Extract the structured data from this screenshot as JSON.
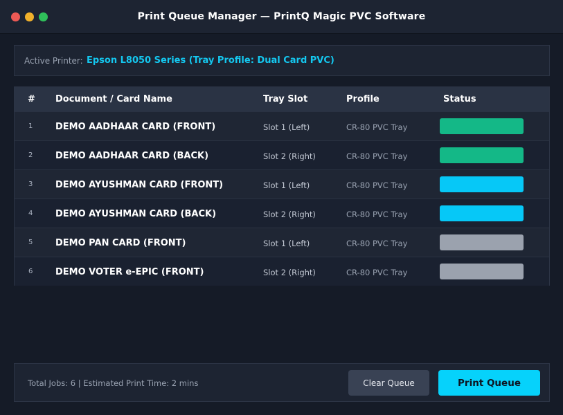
{
  "window": {
    "title": "Print Queue Manager — PrintQ Magic PVC Software"
  },
  "printer": {
    "label": "Active Printer:",
    "value": "Epson L8050 Series (Tray Profile: Dual Card PVC)"
  },
  "table": {
    "headers": [
      "#",
      "Document / Card Name",
      "Tray Slot",
      "Profile",
      "Status"
    ],
    "rows": [
      {
        "num": "1",
        "name": "DEMO AADHAAR CARD (FRONT)",
        "slot": "Slot 1 (Left)",
        "profile": "CR-80 PVC Tray",
        "status_color": "#14b887"
      },
      {
        "num": "2",
        "name": "DEMO AADHAAR CARD (BACK)",
        "slot": "Slot 2 (Right)",
        "profile": "CR-80 PVC Tray",
        "status_color": "#14b887"
      },
      {
        "num": "3",
        "name": "DEMO AYUSHMAN CARD (FRONT)",
        "slot": "Slot 1 (Left)",
        "profile": "CR-80 PVC Tray",
        "status_color": "#06c8f7"
      },
      {
        "num": "4",
        "name": "DEMO AYUSHMAN CARD (BACK)",
        "slot": "Slot 2 (Right)",
        "profile": "CR-80 PVC Tray",
        "status_color": "#06c8f7"
      },
      {
        "num": "5",
        "name": "DEMO PAN CARD (FRONT)",
        "slot": "Slot 1 (Left)",
        "profile": "CR-80 PVC Tray",
        "status_color": "#9ba2ae"
      },
      {
        "num": "6",
        "name": "DEMO VOTER e-EPIC (FRONT)",
        "slot": "Slot 2 (Right)",
        "profile": "CR-80 PVC Tray",
        "status_color": "#9ba2ae"
      }
    ]
  },
  "footer": {
    "summary": "Total Jobs: 6 | Estimated Print Time: 2 mins",
    "clear_label": "Clear Queue",
    "print_label": "Print Queue"
  },
  "colors": {
    "accent": "#06d2fb",
    "done": "#14b887",
    "active": "#06c8f7",
    "pending": "#9ba2ae"
  }
}
